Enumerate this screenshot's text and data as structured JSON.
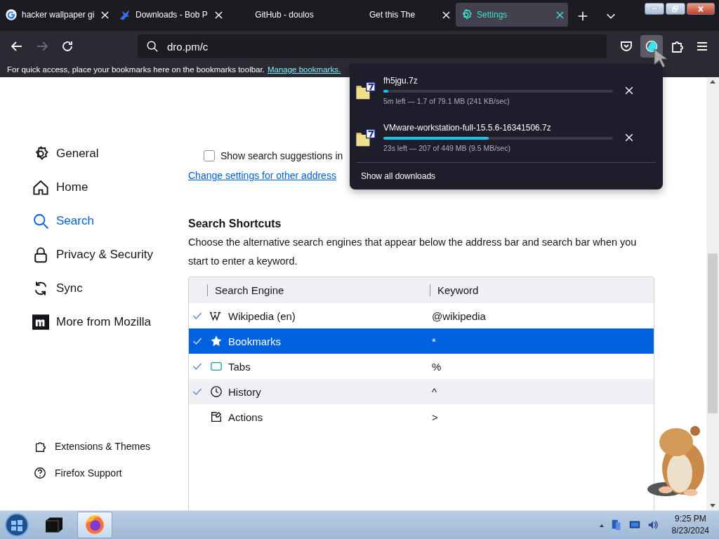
{
  "tabs": [
    {
      "title": "hacker wallpaper gi",
      "kind": "google",
      "selected": false,
      "close": true
    },
    {
      "title": "Downloads - Bob P",
      "kind": "bird",
      "selected": false,
      "close": true
    },
    {
      "title": "GitHub - doulos",
      "kind": "plain",
      "selected": false,
      "close": false
    },
    {
      "title": "Get this The",
      "kind": "plain",
      "selected": false,
      "close": true
    },
    {
      "title": "Settings",
      "kind": "gear",
      "selected": true,
      "close": true
    }
  ],
  "nav_buttons": [
    {
      "kind": "back",
      "disabled": false
    },
    {
      "kind": "forward",
      "disabled": true
    },
    {
      "kind": "reload",
      "disabled": false
    }
  ],
  "address_bar": {
    "value": "dro.pm/c"
  },
  "toolbar_buttons": [
    {
      "kind": "pocket",
      "active": false
    },
    {
      "kind": "downloads",
      "active": true
    },
    {
      "kind": "extensions",
      "active": false
    },
    {
      "kind": "menu",
      "active": false
    }
  ],
  "bookmarks_bar": {
    "text": "For quick access, place your bookmarks here on the bookmarks toolbar.",
    "link": "Manage bookmarks."
  },
  "sidebar": {
    "items": [
      {
        "label": "General",
        "kind": "gear",
        "selected": false
      },
      {
        "label": "Home",
        "kind": "home",
        "selected": false
      },
      {
        "label": "Search",
        "kind": "search",
        "selected": true
      },
      {
        "label": "Privacy & Security",
        "kind": "lock",
        "selected": false
      },
      {
        "label": "Sync",
        "kind": "sync",
        "selected": false
      },
      {
        "label": "More from Mozilla",
        "kind": "mozilla",
        "selected": false
      }
    ],
    "footer": [
      {
        "label": "Extensions & Themes",
        "kind": "puzzle"
      },
      {
        "label": "Firefox Support",
        "kind": "help"
      }
    ]
  },
  "suggestions_checkbox": {
    "label": "Show search suggestions in",
    "checked": false
  },
  "address_bar_link": "Change settings for other address",
  "search_shortcuts": {
    "title": "Search Shortcuts",
    "description": "Choose the alternative search engines that appear below the address bar and search bar when you start to enter a keyword.",
    "columns": [
      "Search Engine",
      "Keyword"
    ],
    "rows": [
      {
        "engine": "Wikipedia (en)",
        "keyword": "@wikipedia",
        "kind": "wikipedia",
        "checked": true,
        "selected": false
      },
      {
        "engine": "Bookmarks",
        "keyword": "*",
        "kind": "star",
        "checked": true,
        "selected": true
      },
      {
        "engine": "Tabs",
        "keyword": "%",
        "kind": "tab",
        "checked": true,
        "selected": false
      },
      {
        "engine": "History",
        "keyword": "^",
        "kind": "clock",
        "checked": true,
        "selected": false
      },
      {
        "engine": "Actions",
        "keyword": ">",
        "kind": "actions",
        "checked": false,
        "selected": false
      }
    ]
  },
  "downloads_panel": {
    "items": [
      {
        "name": "fh5jgu.7z",
        "status": "5m left — 1.7 of 79.1 MB (241 KB/sec)",
        "level": 0.021
      },
      {
        "name": "VMware-workstation-full-15.5.6-16341506.7z",
        "status": "23s left — 207 of 449 MB (9.5 MB/sec)",
        "level": 0.46
      }
    ],
    "footer": "Show all downloads"
  },
  "taskbar": {
    "apps": [
      {
        "kind": "terminal",
        "active": false
      },
      {
        "kind": "firefox",
        "active": true
      }
    ],
    "time": "9:25 PM",
    "date": "8/23/2024"
  }
}
